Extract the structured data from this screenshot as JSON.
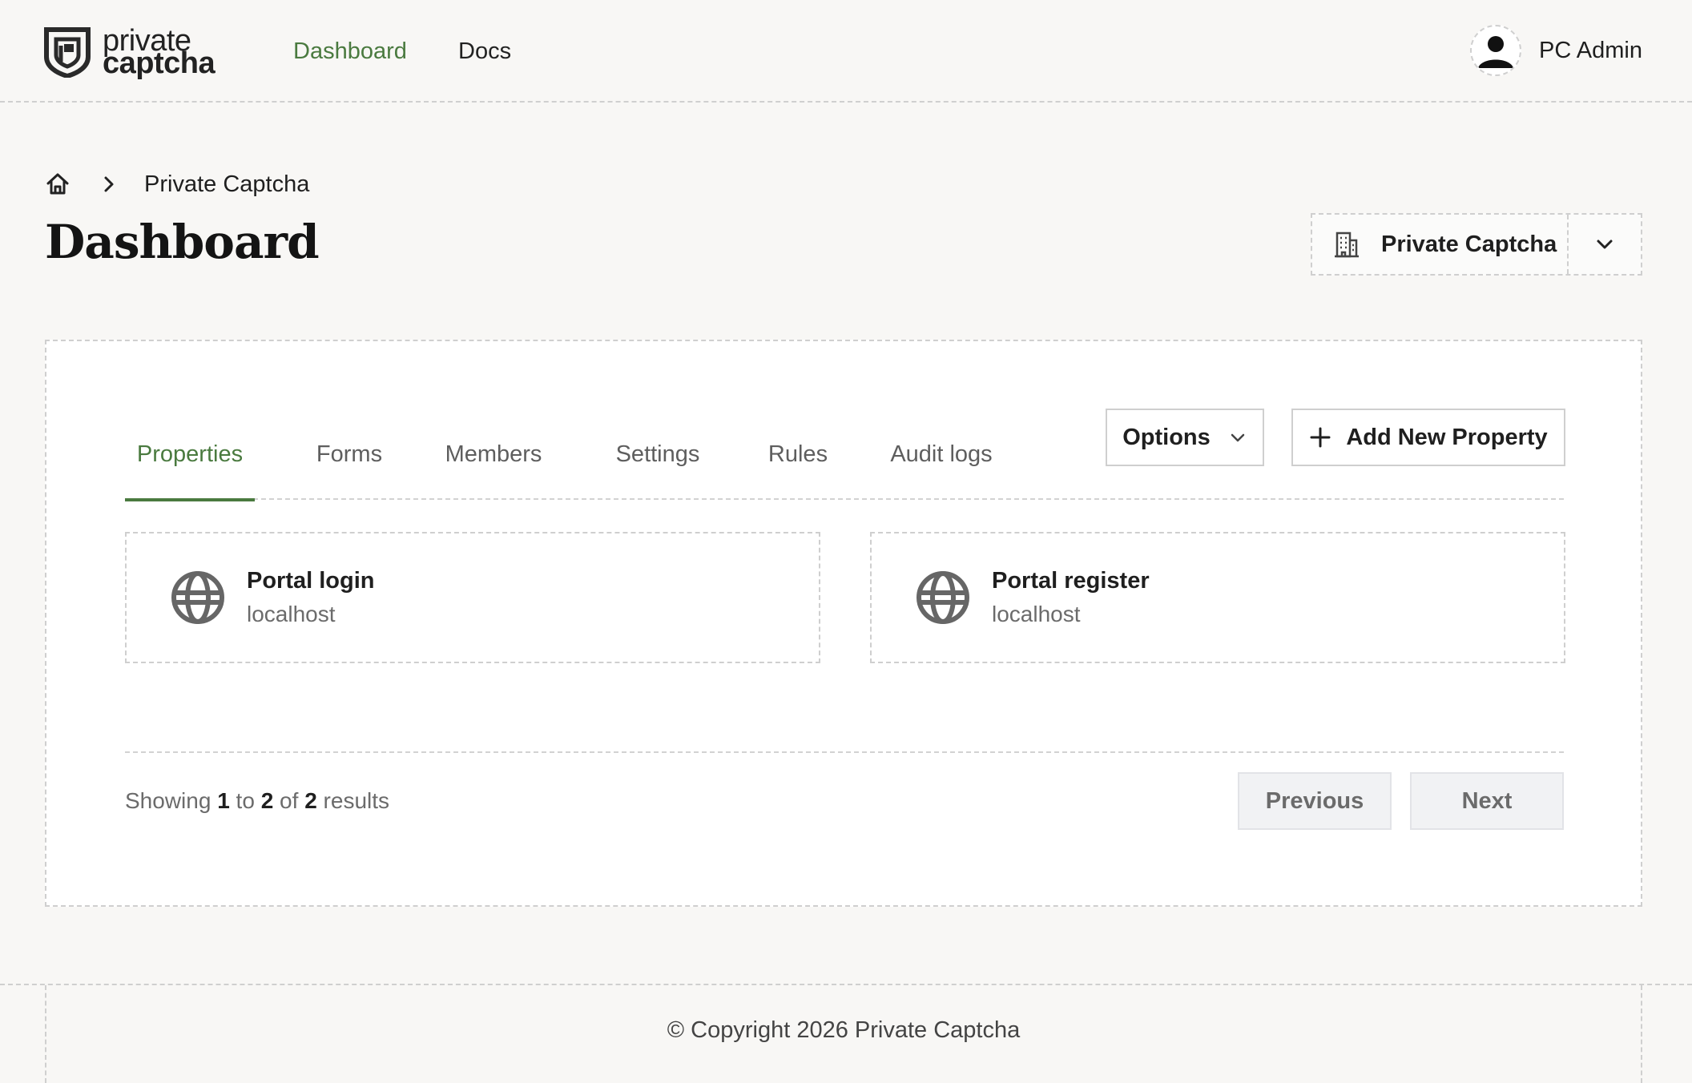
{
  "header": {
    "logo": {
      "line1": "private",
      "line2": "captcha"
    },
    "nav": [
      {
        "label": "Dashboard",
        "active": true
      },
      {
        "label": "Docs",
        "active": false
      }
    ],
    "user": {
      "name": "PC Admin"
    }
  },
  "breadcrumb": {
    "current": "Private Captcha"
  },
  "page": {
    "title": "Dashboard"
  },
  "org_switcher": {
    "label": "Private Captcha"
  },
  "tabs": [
    {
      "label": "Properties",
      "active": true
    },
    {
      "label": "Forms",
      "active": false
    },
    {
      "label": "Members",
      "active": false
    },
    {
      "label": "Settings",
      "active": false
    },
    {
      "label": "Rules",
      "active": false
    },
    {
      "label": "Audit logs",
      "active": false
    }
  ],
  "actions": {
    "options_label": "Options",
    "add_label": "Add New Property"
  },
  "properties": [
    {
      "name": "Portal login",
      "host": "localhost"
    },
    {
      "name": "Portal register",
      "host": "localhost"
    }
  ],
  "pagination": {
    "showing_prefix": "Showing",
    "from": "1",
    "to_word": "to",
    "to": "2",
    "of_word": "of",
    "total": "2",
    "suffix": "results",
    "previous_label": "Previous",
    "next_label": "Next"
  },
  "footer": {
    "copyright": "© Copyright 2026 Private Captcha"
  },
  "colors": {
    "accent": "#4a7a3f",
    "background": "#f8f7f5",
    "border": "#cfcfcf"
  }
}
